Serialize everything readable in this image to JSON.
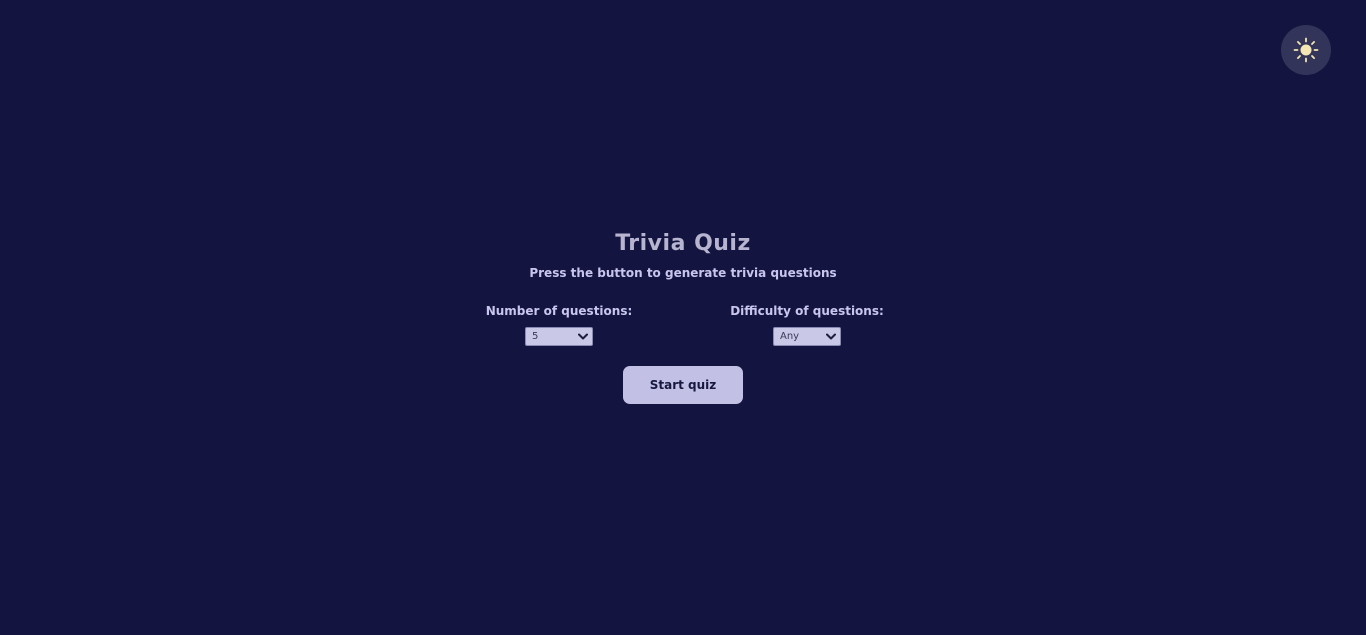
{
  "theme_toggle": {
    "icon": "sun-icon"
  },
  "header": {
    "title": "Trivia Quiz",
    "subtitle": "Press the button to generate trivia questions"
  },
  "settings": {
    "questions": {
      "label": "Number of questions:",
      "value": "5"
    },
    "difficulty": {
      "label": "Difficulty of questions:",
      "value": "Any"
    }
  },
  "actions": {
    "start_label": "Start quiz"
  },
  "colors": {
    "background": "#131440",
    "text": "#c8c6ee",
    "title": "#b6b4cf",
    "button": "#c2c1e5",
    "toggle": "#33345a"
  }
}
